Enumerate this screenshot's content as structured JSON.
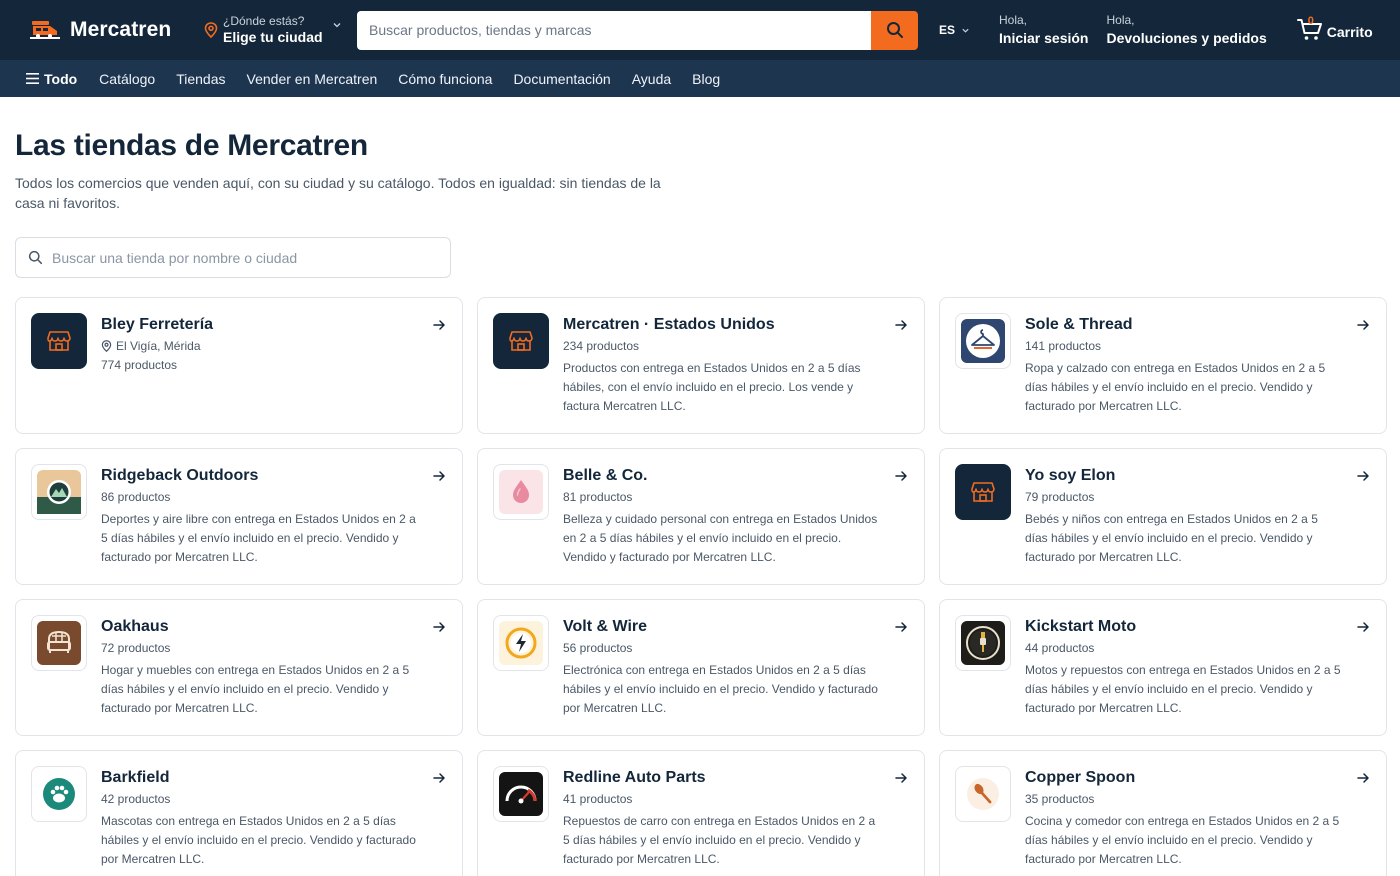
{
  "header": {
    "brand": "Mercatren",
    "location_small": "¿Dónde estás?",
    "location_big": "Elige tu ciudad",
    "search_placeholder": "Buscar productos, tiendas y marcas",
    "lang": "ES",
    "signin_small": "Hola,",
    "signin_big": "Iniciar sesión",
    "orders_small": "Hola,",
    "orders_big": "Devoluciones y pedidos",
    "cart_count": "0",
    "cart_label": "Carrito"
  },
  "nav": {
    "all": "Todo",
    "links": [
      "Catálogo",
      "Tiendas",
      "Vender en Mercatren",
      "Cómo funciona",
      "Documentación",
      "Ayuda",
      "Blog"
    ]
  },
  "page": {
    "title": "Las tiendas de Mercatren",
    "subtitle": "Todos los comercios que venden aquí, con su ciudad y su catálogo. Todos en igualdad: sin tiendas de la casa ni favoritos.",
    "filter_placeholder": "Buscar una tienda por nombre o ciudad"
  },
  "stores": [
    {
      "name": "Bley Ferretería",
      "location": "El Vigía, Mérida",
      "count": "774 productos",
      "desc": "",
      "icon": "store-icon"
    },
    {
      "name": "Mercatren · Estados Unidos",
      "location": "",
      "count": "234 productos",
      "desc": "Productos con entrega en Estados Unidos en 2 a 5 días hábiles, con el envío incluido en el precio. Los vende y factura Mercatren LLC.",
      "icon": "store-icon"
    },
    {
      "name": "Sole & Thread",
      "location": "",
      "count": "141 productos",
      "desc": "Ropa y calzado con entrega en Estados Unidos en 2 a 5 días hábiles y el envío incluido en el precio. Vendido y facturado por Mercatren LLC.",
      "icon": "hanger-icon"
    },
    {
      "name": "Ridgeback Outdoors",
      "location": "",
      "count": "86 productos",
      "desc": "Deportes y aire libre con entrega en Estados Unidos en 2 a 5 días hábiles y el envío incluido en el precio. Vendido y facturado por Mercatren LLC.",
      "icon": "mountain-icon"
    },
    {
      "name": "Belle & Co.",
      "location": "",
      "count": "81 productos",
      "desc": "Belleza y cuidado personal con entrega en Estados Unidos en 2 a 5 días hábiles y el envío incluido en el precio. Vendido y facturado por Mercatren LLC.",
      "icon": "drop-icon"
    },
    {
      "name": "Yo soy Elon",
      "location": "",
      "count": "79 productos",
      "desc": "Bebés y niños con entrega en Estados Unidos en 2 a 5 días hábiles y el envío incluido en el precio. Vendido y facturado por Mercatren LLC.",
      "icon": "store-icon"
    },
    {
      "name": "Oakhaus",
      "location": "",
      "count": "72 productos",
      "desc": "Hogar y muebles con entrega en Estados Unidos en 2 a 5 días hábiles y el envío incluido en el precio. Vendido y facturado por Mercatren LLC.",
      "icon": "armchair-icon"
    },
    {
      "name": "Volt & Wire",
      "location": "",
      "count": "56 productos",
      "desc": "Electrónica con entrega en Estados Unidos en 2 a 5 días hábiles y el envío incluido en el precio. Vendido y facturado por Mercatren LLC.",
      "icon": "bolt-icon"
    },
    {
      "name": "Kickstart Moto",
      "location": "",
      "count": "44 productos",
      "desc": "Motos y repuestos con entrega en Estados Unidos en 2 a 5 días hábiles y el envío incluido en el precio. Vendido y facturado por Mercatren LLC.",
      "icon": "spark-plug-icon"
    },
    {
      "name": "Barkfield",
      "location": "",
      "count": "42 productos",
      "desc": "Mascotas con entrega en Estados Unidos en 2 a 5 días hábiles y el envío incluido en el precio. Vendido y facturado por Mercatren LLC.",
      "icon": "paw-icon"
    },
    {
      "name": "Redline Auto Parts",
      "location": "",
      "count": "41 productos",
      "desc": "Repuestos de carro con entrega en Estados Unidos en 2 a 5 días hábiles y el envío incluido en el precio. Vendido y facturado por Mercatren LLC.",
      "icon": "speedometer-icon"
    },
    {
      "name": "Copper Spoon",
      "location": "",
      "count": "35 productos",
      "desc": "Cocina y comedor con entrega en Estados Unidos en 2 a 5 días hábiles y el envío incluido en el precio. Vendido y facturado por Mercatren LLC.",
      "icon": "spoon-icon"
    }
  ],
  "colors": {
    "header_bg": "#14273a",
    "nav_bg": "#1e3550",
    "accent": "#f26b1f",
    "text": "#13263a"
  }
}
